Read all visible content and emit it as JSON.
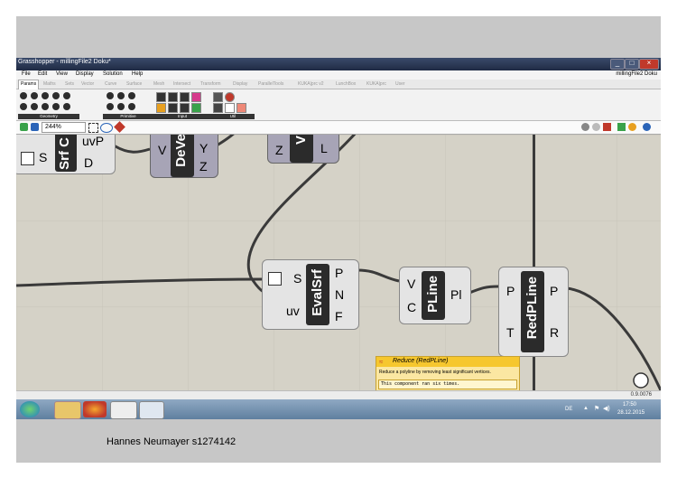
{
  "window": {
    "title": "Grasshopper - millingFile2 Doku*",
    "doc_name": "millingFile2 Doku",
    "controls": {
      "minimize": "_",
      "maximize": "□",
      "close": "×"
    }
  },
  "menu": [
    "File",
    "Edit",
    "View",
    "Display",
    "Solution",
    "Help"
  ],
  "tabs": [
    {
      "label": "Params",
      "active": true
    },
    {
      "label": "Maths",
      "active": false
    },
    {
      "label": "Sets",
      "active": false
    },
    {
      "label": "Vector",
      "active": false
    },
    {
      "label": "Curve",
      "active": false
    },
    {
      "label": "Surface",
      "active": false
    },
    {
      "label": "Mesh",
      "active": false
    },
    {
      "label": "Intersect",
      "active": false
    },
    {
      "label": "Transform",
      "active": false
    },
    {
      "label": "Display",
      "active": false
    },
    {
      "label": "ParallelTools",
      "active": false
    },
    {
      "label": "KUKA|prc v2",
      "active": false
    },
    {
      "label": "LunchBox",
      "active": false
    },
    {
      "label": "KUKA|prc",
      "active": false
    },
    {
      "label": "User",
      "active": false
    }
  ],
  "ribbon_groups": [
    "Geometry",
    "Primitive",
    "Input",
    "Util"
  ],
  "toolbar": {
    "zoom": "244%"
  },
  "components": {
    "surface": {
      "label": "Srf C",
      "inputs": [
        "S"
      ],
      "outputs": [
        "uvP",
        "D"
      ]
    },
    "deconstruct": {
      "label": "DeVe",
      "inputs": [
        "V"
      ],
      "outputs": [
        "Y",
        "Z"
      ]
    },
    "vector": {
      "label": "V",
      "inputs": [
        "Z"
      ],
      "outputs": [
        "L"
      ]
    },
    "evalsrf": {
      "label": "EvalSrf",
      "inputs": [
        "S",
        "uv"
      ],
      "outputs": [
        "P",
        "N",
        "F"
      ]
    },
    "pline": {
      "label": "PLine",
      "inputs": [
        "V",
        "C"
      ],
      "outputs": [
        "Pl"
      ]
    },
    "redpline": {
      "label": "RedPLine",
      "inputs": [
        "P",
        "T"
      ],
      "outputs": [
        "P",
        "R"
      ]
    }
  },
  "tooltip": {
    "title": "Reduce (RedPLine)",
    "description": "Reduce a polyline by removing least significant vertices.",
    "note": "This component ran six times."
  },
  "status": {
    "version": "0.9.0076"
  },
  "taskbar": {
    "lang": "DE",
    "time": "17:50",
    "date": "28.12.2015"
  },
  "caption": "Hannes Neumayer s1274142"
}
